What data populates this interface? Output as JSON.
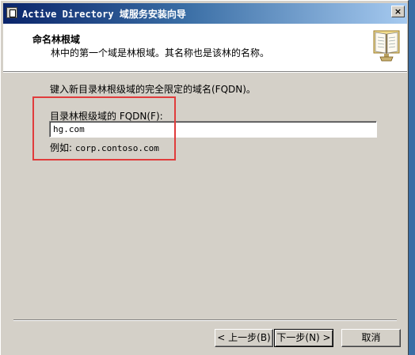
{
  "window": {
    "title": "Active Directory 域服务安装向导",
    "close_label": "×"
  },
  "header": {
    "title": "命名林根域",
    "subtitle": "林中的第一个域是林根域。其名称也是该林的名称。"
  },
  "main": {
    "instruction": "键入新目录林根级域的完全限定的域名(FQDN)。",
    "fqdn_label": "目录林根级域的 FQDN(F):",
    "fqdn_value": "hg.com",
    "example_prefix": "例如:",
    "example_value": "corp.contoso.com"
  },
  "buttons": {
    "back": "< 上一步(B)",
    "next": "下一步(N) >",
    "cancel": "取消"
  },
  "colors": {
    "titlebar_start": "#0a246a",
    "titlebar_end": "#a6caf0",
    "highlight_box": "#e03c3c",
    "dialog_face": "#d4d0c8"
  },
  "icons": {
    "title_icon": "ad-wizard-icon",
    "header_icon": "open-book-icon"
  }
}
